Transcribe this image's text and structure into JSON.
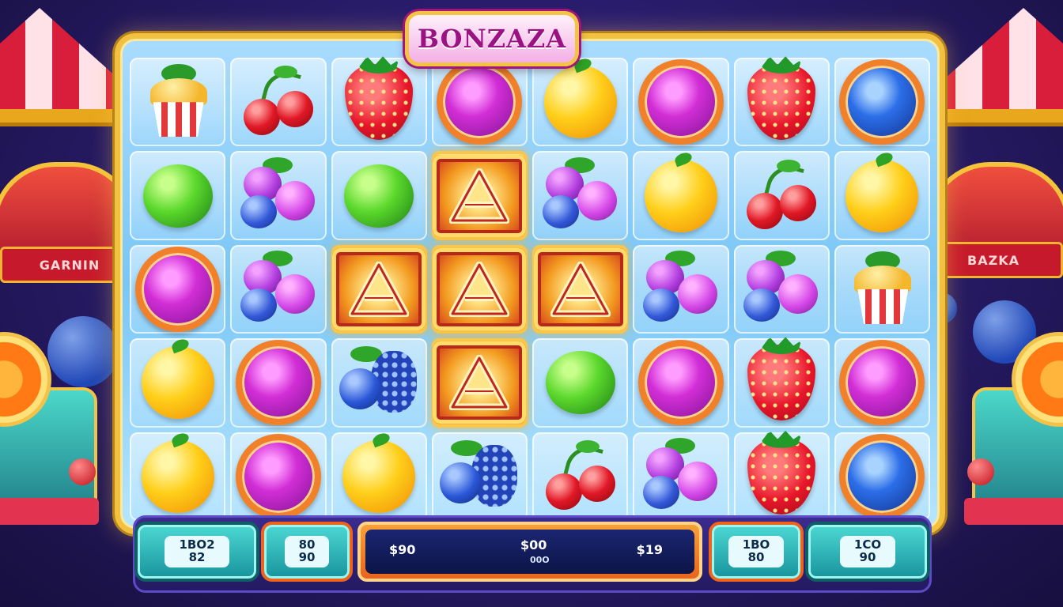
{
  "logo": {
    "text": "BONZAZA"
  },
  "scenery": {
    "left_banner": "GARNIN",
    "right_banner": "BAZKA"
  },
  "grid": {
    "columns": 8,
    "rows": [
      [
        "cupcake",
        "cherry",
        "strawberry",
        "purple-orb",
        "lemon",
        "purple-orb",
        "strawberry",
        "blue-orb"
      ],
      [
        "lime",
        "grapes",
        "lime",
        "scatter",
        "grapes",
        "lemon",
        "cherry",
        "lemon"
      ],
      [
        "purple-orb",
        "grapes",
        "scatter",
        "scatter",
        "scatter",
        "grapes",
        "grapes",
        "cupcake"
      ],
      [
        "lemon",
        "purple-orb",
        "berry",
        "scatter",
        "lime",
        "purple-orb",
        "strawberry",
        "purple-orb"
      ],
      [
        "lemon",
        "purple-orb",
        "lemon",
        "berry",
        "cherry",
        "grapes",
        "strawberry",
        "blue-orb"
      ]
    ]
  },
  "controls": {
    "left_outer": {
      "line1": "1BO2",
      "line2": "82"
    },
    "left_inner": {
      "line1": "80",
      "line2": "90"
    },
    "display": {
      "left": "$90",
      "center": "$00",
      "center_sub": "00O",
      "right": "$19"
    },
    "right_inner": {
      "line1": "1BO",
      "line2": "80"
    },
    "right_outer": {
      "line1": "1CO",
      "line2": "90"
    }
  },
  "colors": {
    "frame": "#f2c13f",
    "accent": "#a3157d",
    "button": "#17939c"
  }
}
